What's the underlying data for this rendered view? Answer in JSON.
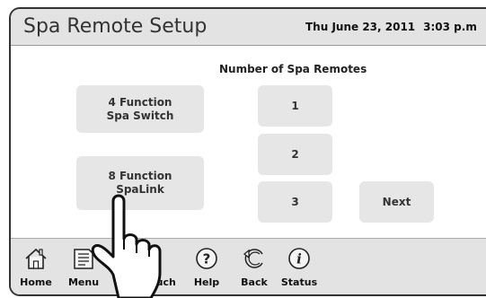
{
  "header": {
    "title": "Spa Remote Setup",
    "date": "Thu June 23, 2011",
    "time": "3:03 p.m"
  },
  "main": {
    "remotes_heading": "Number of Spa Remotes",
    "function_buttons": [
      {
        "label": "4 Function\nSpa  Switch"
      },
      {
        "label": "8 Function\nSpaLink"
      }
    ],
    "remote_count_buttons": [
      {
        "label": "1"
      },
      {
        "label": "2"
      },
      {
        "label": "3"
      }
    ],
    "next_label": "Next"
  },
  "nav": {
    "home": {
      "label": "Home",
      "icon": "home-icon"
    },
    "menu": {
      "label": "Menu",
      "icon": "menu-icon"
    },
    "touch": {
      "label": "ouch",
      "icon": "touch-icon"
    },
    "help": {
      "label": "Help",
      "icon": "help-icon"
    },
    "back": {
      "label": "Back",
      "icon": "back-icon"
    },
    "status": {
      "label": "Status",
      "icon": "status-icon"
    }
  },
  "colors": {
    "bar_background": "#e3e3e3",
    "button_background": "#e6e6e6",
    "text": "#333333"
  }
}
